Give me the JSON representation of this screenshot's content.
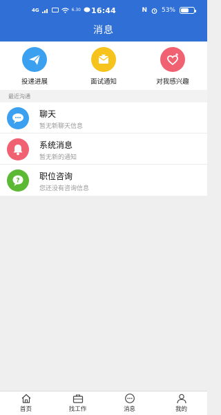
{
  "status": {
    "network": "4G",
    "speed": "6.30",
    "time": "16:44",
    "nfc": "N",
    "battery": "53%"
  },
  "header": {
    "title": "消息"
  },
  "quick_actions": [
    {
      "label": "投递进展",
      "icon": "paper-plane-icon",
      "color": "#3ca0f0"
    },
    {
      "label": "面试通知",
      "icon": "envelope-heart-icon",
      "color": "#f6c21c"
    },
    {
      "label": "对我感兴趣",
      "icon": "heart-icon",
      "color": "#f06272"
    }
  ],
  "section": {
    "label": "最近沟通"
  },
  "conversations": [
    {
      "title": "聊天",
      "subtitle": "暂无新聊天信息",
      "icon": "chat-bubble-icon",
      "color": "#3ca0f0"
    },
    {
      "title": "系统消息",
      "subtitle": "暂无新的通知",
      "icon": "bell-icon",
      "color": "#f06272"
    },
    {
      "title": "职位咨询",
      "subtitle": "您还没有咨询信息",
      "icon": "question-bubble-icon",
      "color": "#5cb934"
    }
  ],
  "tabbar": [
    {
      "label": "首页",
      "icon": "home-icon"
    },
    {
      "label": "找工作",
      "icon": "briefcase-icon"
    },
    {
      "label": "消息",
      "icon": "message-icon"
    },
    {
      "label": "我的",
      "icon": "user-icon"
    }
  ]
}
